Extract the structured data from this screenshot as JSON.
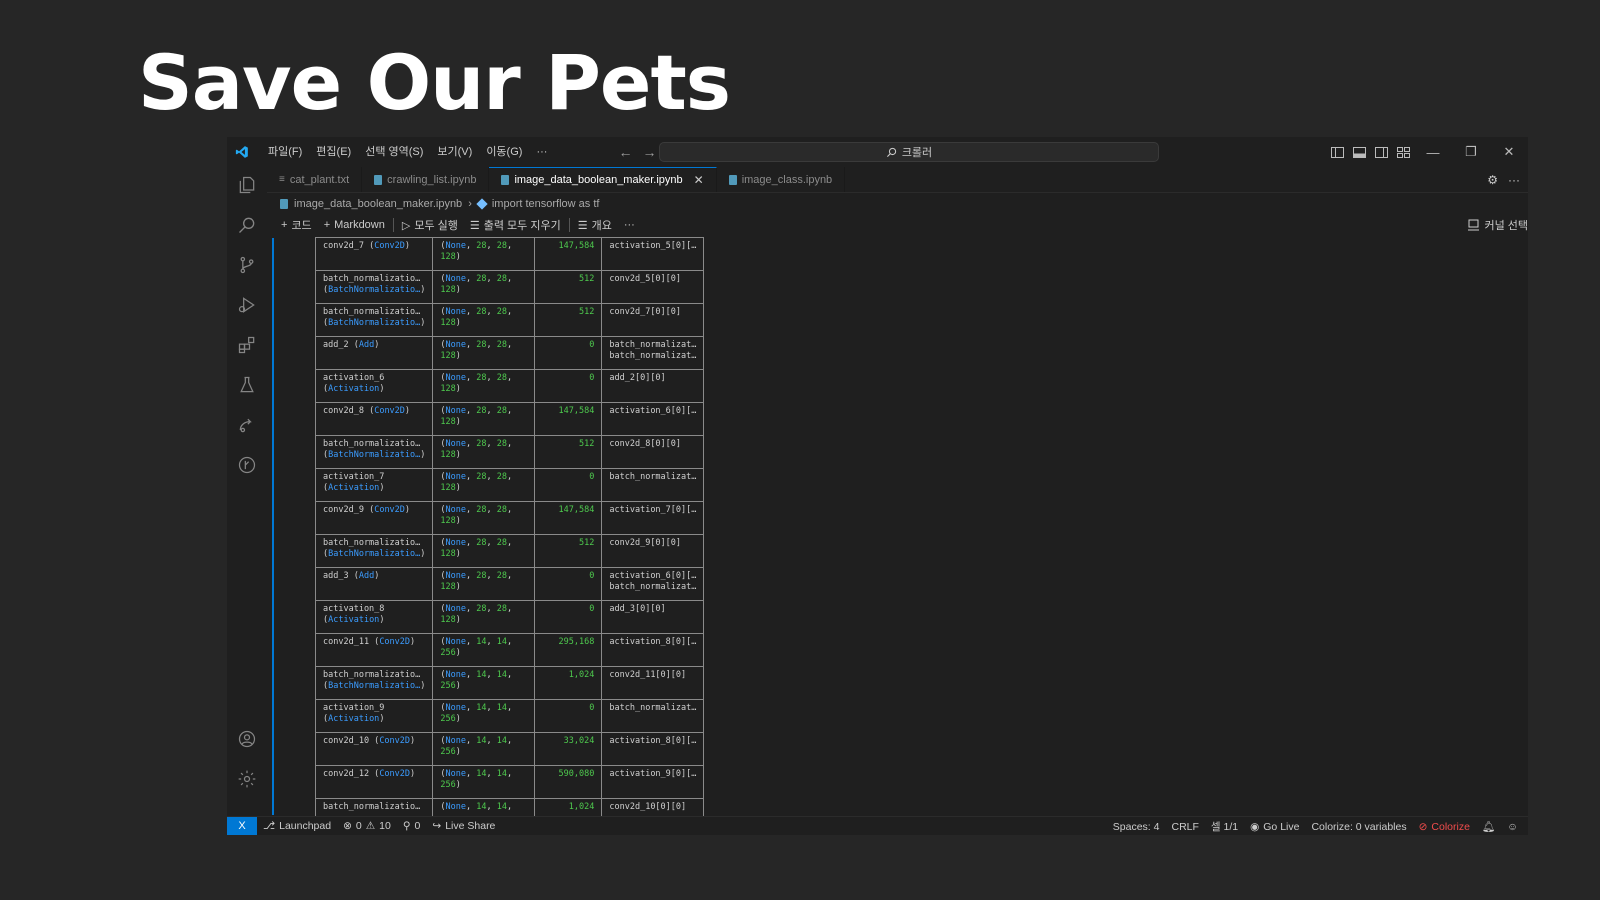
{
  "slide": {
    "title": "Save Our Pets"
  },
  "window": {
    "menu": [
      "파일(F)",
      "편집(E)",
      "선택 영역(S)",
      "보기(V)",
      "이동(G)",
      "···"
    ],
    "command_center": "크롤러",
    "tabs": [
      {
        "label": "cat_plant.txt",
        "icon": "text-file-icon"
      },
      {
        "label": "crawling_list.ipynb",
        "icon": "notebook-file-icon"
      },
      {
        "label": "image_data_boolean_maker.ipynb",
        "icon": "notebook-file-icon",
        "active": true
      },
      {
        "label": "image_class.ipynb",
        "icon": "notebook-file-icon"
      }
    ],
    "breadcrumb": {
      "file": "image_data_boolean_maker.ipynb",
      "symbol": "import tensorflow as tf"
    },
    "toolbar": {
      "code": "코드",
      "markdown": "Markdown",
      "run_all": "모두 실행",
      "clear_outputs": "출력 모두 지우기",
      "outline": "개요",
      "more": "···",
      "kernel": "커널 선택"
    },
    "status": {
      "remote": "X",
      "launchpad": "Launchpad",
      "errors": "0",
      "warnings": "10",
      "ports": "0",
      "live_share": "Live Share",
      "spaces": "Spaces: 4",
      "eol": "CRLF",
      "cell": "셀 1/1",
      "go_live": "Go Live",
      "colorize_vars": "Colorize: 0 variables",
      "colorize": "Colorize"
    },
    "colors": {
      "accent": "#0078d4",
      "background": "#1f1f1f",
      "param_green": "#4ec94e",
      "type_blue": "#3b9cff",
      "error_red": "#f14c4c"
    }
  },
  "model_summary": {
    "rows": [
      {
        "layer": "conv2d_7",
        "type": "Conv2D",
        "shape": [
          "None",
          "28",
          "28",
          "128"
        ],
        "params": "147,584",
        "connected": [
          "activation_5[0][…"
        ]
      },
      {
        "layer": "batch_normalizatio…",
        "type": "BatchNormalizatio…",
        "shape": [
          "None",
          "28",
          "28",
          "128"
        ],
        "params": "512",
        "connected": [
          "conv2d_5[0][0]"
        ]
      },
      {
        "layer": "batch_normalizatio…",
        "type": "BatchNormalizatio…",
        "shape": [
          "None",
          "28",
          "28",
          "128"
        ],
        "params": "512",
        "connected": [
          "conv2d_7[0][0]"
        ]
      },
      {
        "layer": "add_2",
        "type": "Add",
        "shape": [
          "None",
          "28",
          "28",
          "128"
        ],
        "params": "0",
        "connected": [
          "batch_normalizat…",
          "batch_normalizat…"
        ]
      },
      {
        "layer": "activation_6",
        "type": "Activation",
        "shape": [
          "None",
          "28",
          "28",
          "128"
        ],
        "params": "0",
        "connected": [
          "add_2[0][0]"
        ]
      },
      {
        "layer": "conv2d_8",
        "type": "Conv2D",
        "shape": [
          "None",
          "28",
          "28",
          "128"
        ],
        "params": "147,584",
        "connected": [
          "activation_6[0][…"
        ]
      },
      {
        "layer": "batch_normalizatio…",
        "type": "BatchNormalizatio…",
        "shape": [
          "None",
          "28",
          "28",
          "128"
        ],
        "params": "512",
        "connected": [
          "conv2d_8[0][0]"
        ]
      },
      {
        "layer": "activation_7",
        "type": "Activation",
        "shape": [
          "None",
          "28",
          "28",
          "128"
        ],
        "params": "0",
        "connected": [
          "batch_normalizat…"
        ]
      },
      {
        "layer": "conv2d_9",
        "type": "Conv2D",
        "shape": [
          "None",
          "28",
          "28",
          "128"
        ],
        "params": "147,584",
        "connected": [
          "activation_7[0][…"
        ]
      },
      {
        "layer": "batch_normalizatio…",
        "type": "BatchNormalizatio…",
        "shape": [
          "None",
          "28",
          "28",
          "128"
        ],
        "params": "512",
        "connected": [
          "conv2d_9[0][0]"
        ]
      },
      {
        "layer": "add_3",
        "type": "Add",
        "shape": [
          "None",
          "28",
          "28",
          "128"
        ],
        "params": "0",
        "connected": [
          "activation_6[0][…",
          "batch_normalizat…"
        ]
      },
      {
        "layer": "activation_8",
        "type": "Activation",
        "shape": [
          "None",
          "28",
          "28",
          "128"
        ],
        "params": "0",
        "connected": [
          "add_3[0][0]"
        ]
      },
      {
        "layer": "conv2d_11",
        "type": "Conv2D",
        "shape": [
          "None",
          "14",
          "14",
          "256"
        ],
        "params": "295,168",
        "connected": [
          "activation_8[0][…"
        ]
      },
      {
        "layer": "batch_normalizatio…",
        "type": "BatchNormalizatio…",
        "shape": [
          "None",
          "14",
          "14",
          "256"
        ],
        "params": "1,024",
        "connected": [
          "conv2d_11[0][0]"
        ]
      },
      {
        "layer": "activation_9",
        "type": "Activation",
        "shape": [
          "None",
          "14",
          "14",
          "256"
        ],
        "params": "0",
        "connected": [
          "batch_normalizat…"
        ]
      },
      {
        "layer": "conv2d_10",
        "type": "Conv2D",
        "shape": [
          "None",
          "14",
          "14",
          "256"
        ],
        "params": "33,024",
        "connected": [
          "activation_8[0][…"
        ]
      },
      {
        "layer": "conv2d_12",
        "type": "Conv2D",
        "shape": [
          "None",
          "14",
          "14",
          "256"
        ],
        "params": "590,080",
        "connected": [
          "activation_9[0][…"
        ]
      },
      {
        "layer": "batch_normalizatio…",
        "type": "",
        "shape": [
          "None",
          "14",
          "14",
          ""
        ],
        "params": "1,024",
        "connected": [
          "conv2d_10[0][0]"
        ]
      }
    ]
  }
}
